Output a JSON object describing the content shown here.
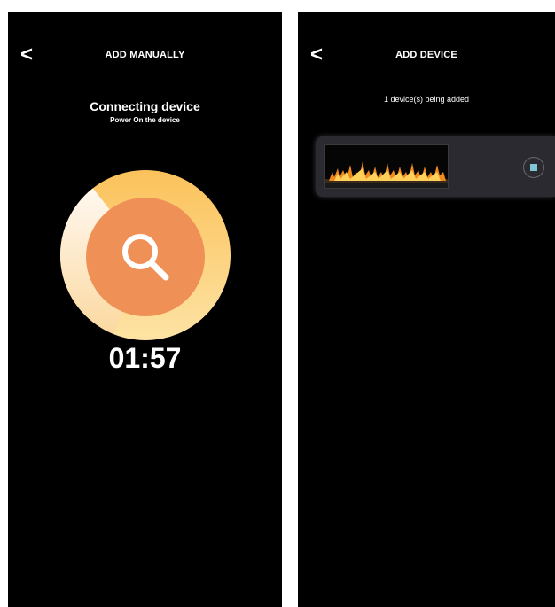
{
  "left_screen": {
    "back_label": "<",
    "title": "ADD MANUALLY",
    "status_title": "Connecting device",
    "status_subtitle": "Power On the device",
    "timer": "01:57",
    "icon": "search-icon",
    "colors": {
      "ring": "#fbc25b",
      "ring_remaining": "#fff3e0",
      "circle": "#ef9157"
    }
  },
  "right_screen": {
    "back_label": "<",
    "title": "ADD DEVICE",
    "added_text": "1 device(s) being added",
    "device": {
      "thumbnail": "fireplace-image",
      "action_icon": "stop-icon"
    },
    "colors": {
      "card": "#2a2a30",
      "stop": "#7fc6d6"
    }
  }
}
